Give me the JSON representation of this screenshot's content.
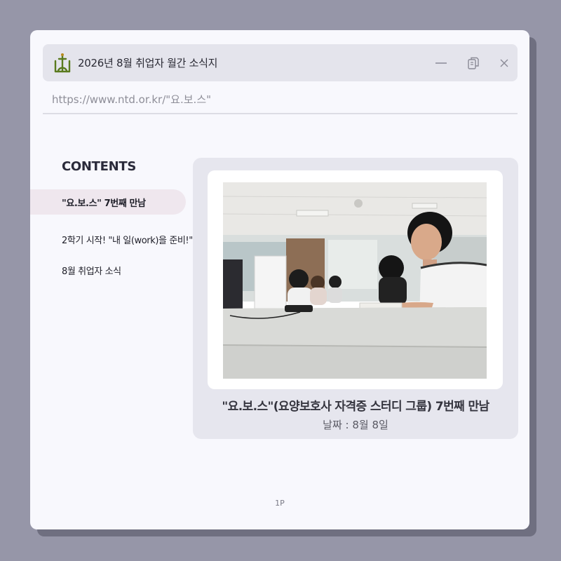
{
  "window": {
    "title": "2026년 8월 취업자 월간 소식지",
    "url": "https://www.ntd.or.kr/\"요.보.스\"",
    "logo_icon": "organization-logo",
    "controls": [
      "minimize-icon",
      "copy-icon",
      "close-icon"
    ]
  },
  "sidebar": {
    "heading": "CONTENTS",
    "items": [
      {
        "label": "\"요.보.스\" 7번째 만남",
        "active": true
      },
      {
        "label": "2학기 시작! \"내 일(work)을 준비!\"",
        "active": false
      },
      {
        "label": "8월 취업자 소식",
        "active": false
      }
    ]
  },
  "article": {
    "photo": "study-group-classroom-photo",
    "caption": "\"요.보.스\"(요양보호사 자격증 스터디 그룹) 7번째 만남",
    "date": "날짜 : 8월 8일"
  },
  "footer": {
    "page": "1P"
  },
  "colors": {
    "background": "#9696a8",
    "window": "#f8f8fd",
    "titlebar": "#e4e4ec",
    "active_item": "#efe7ee",
    "card": "#e6e6ee",
    "logo_green": "#5a7a1e"
  }
}
